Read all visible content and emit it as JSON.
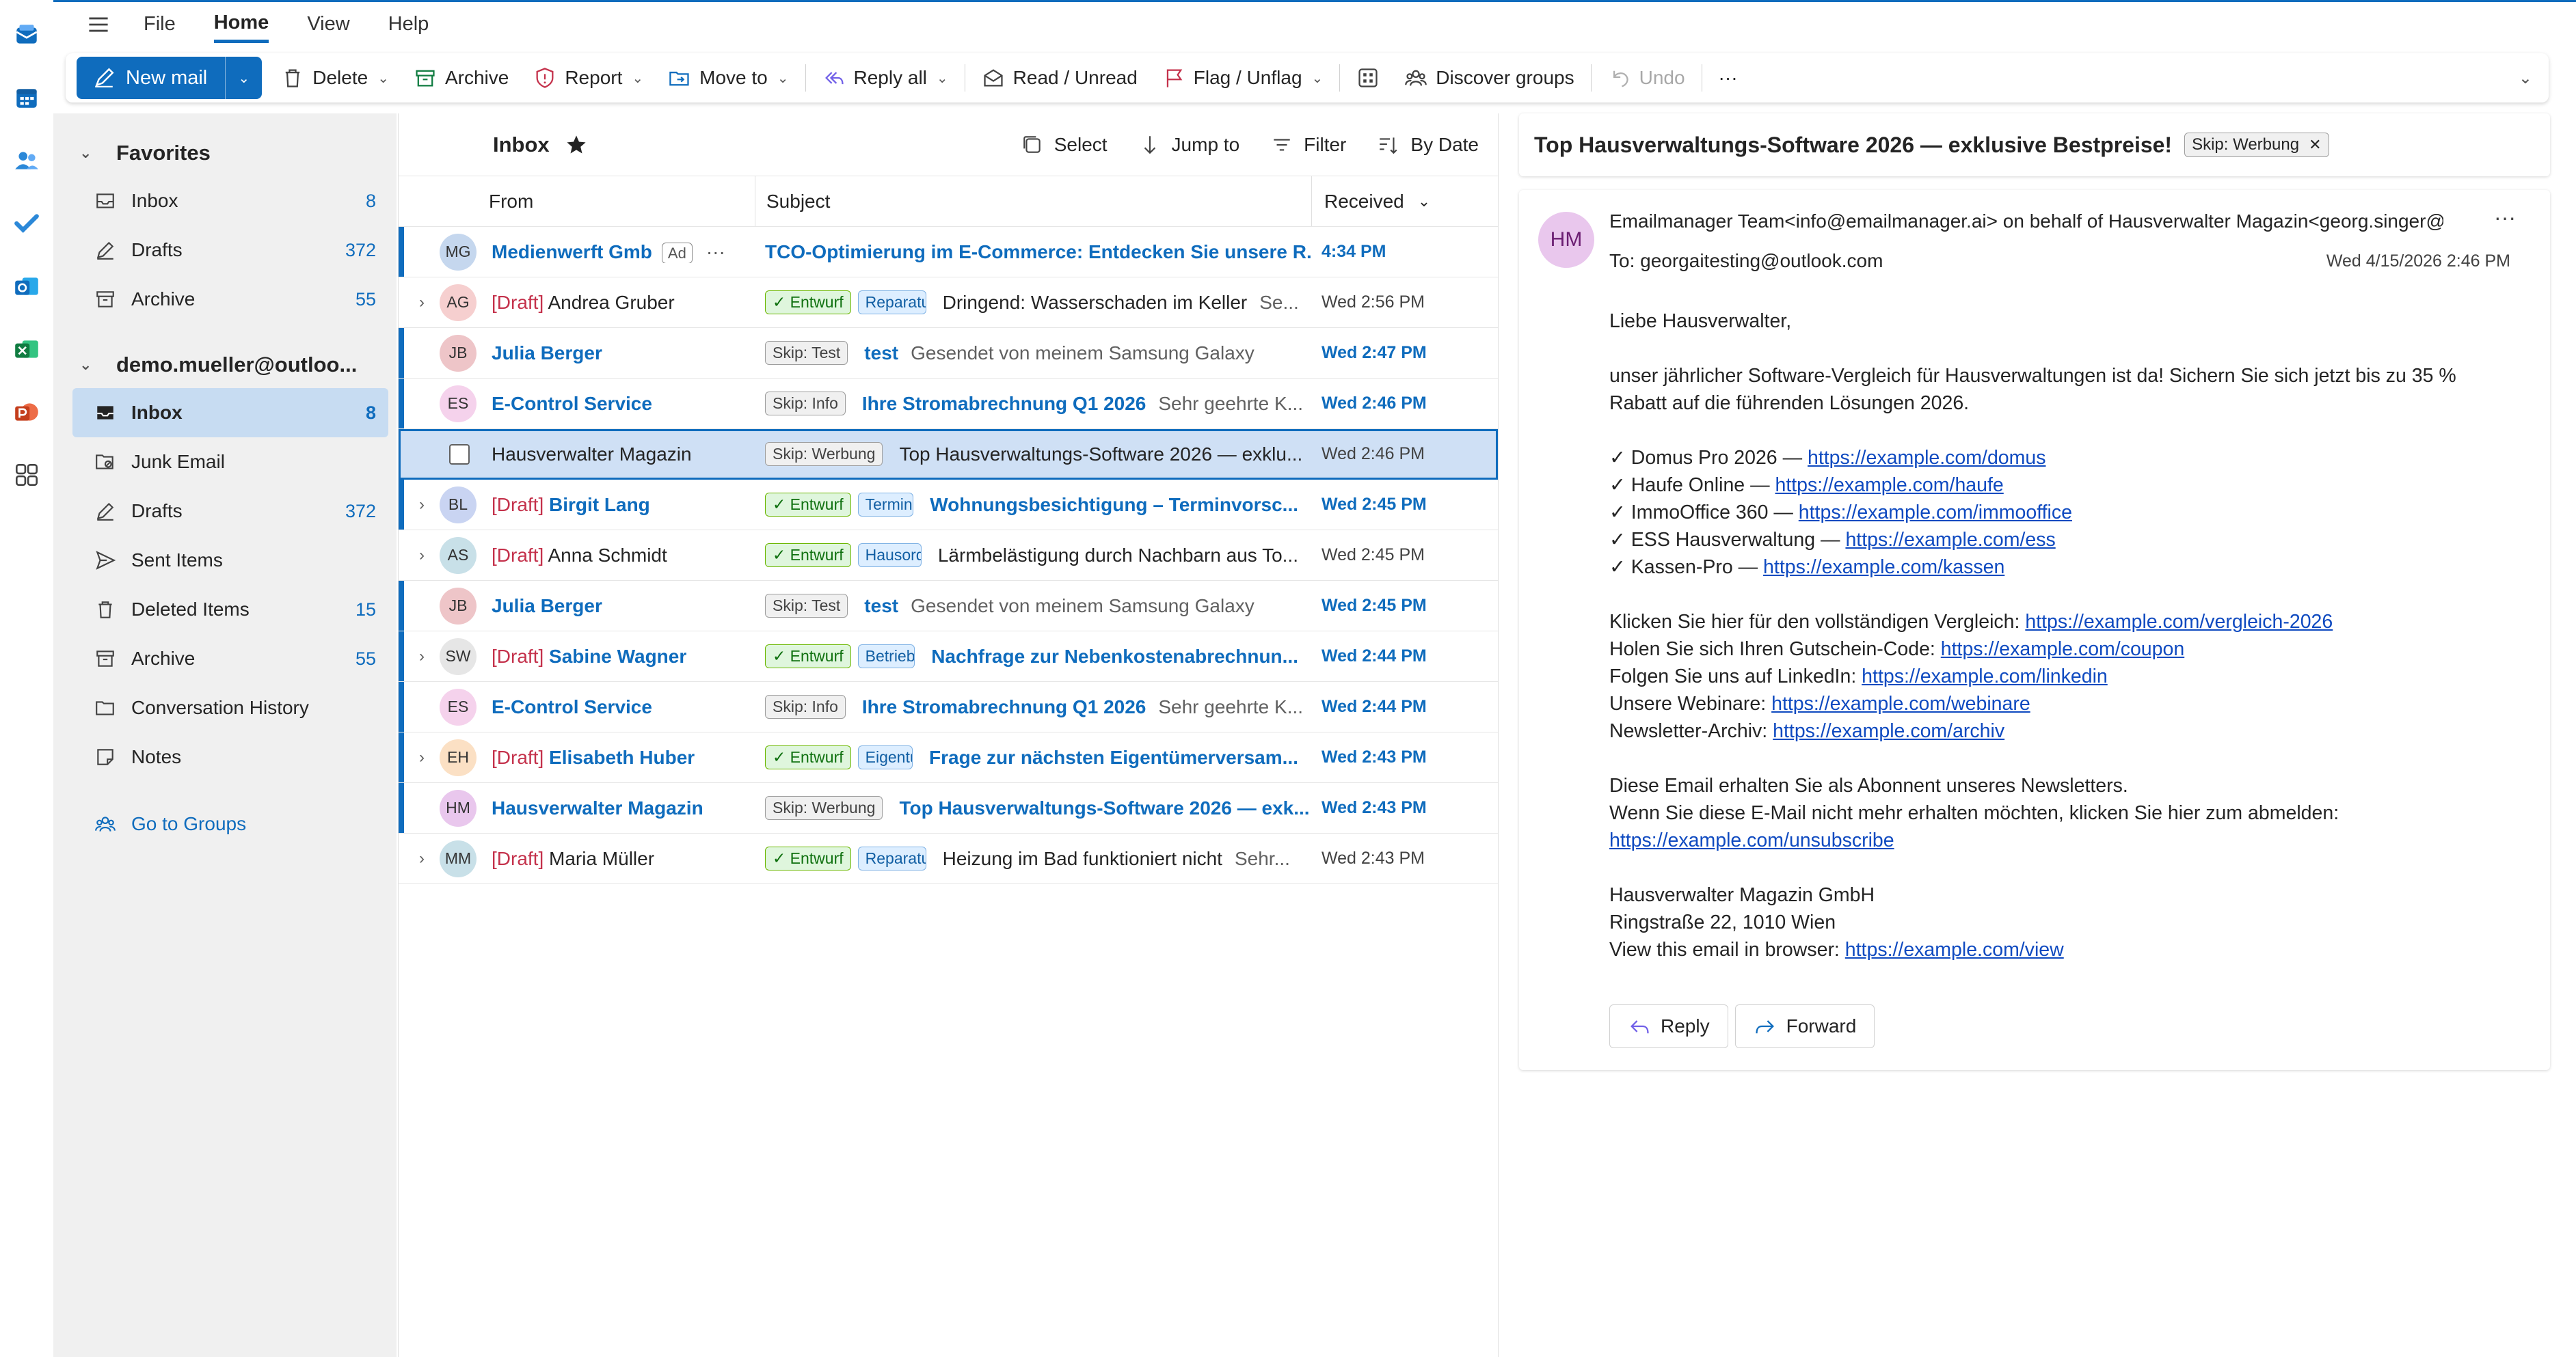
{
  "menubar": {
    "menus": [
      "File",
      "Home",
      "View",
      "Help"
    ],
    "active": "Home"
  },
  "ribbon": {
    "new_mail": "New mail",
    "delete": "Delete",
    "archive": "Archive",
    "report": "Report",
    "move_to": "Move to",
    "reply_all": "Reply all",
    "read_unread": "Read / Unread",
    "flag_unflag": "Flag / Unflag",
    "discover_groups": "Discover groups",
    "undo": "Undo",
    "more": "···",
    "accent": "#0f6cbd"
  },
  "folders": {
    "favorites_label": "Favorites",
    "favorites": [
      {
        "label": "Inbox",
        "count": "8",
        "icon": "inbox-icon"
      },
      {
        "label": "Drafts",
        "count": "372",
        "icon": "drafts-icon"
      },
      {
        "label": "Archive",
        "count": "55",
        "icon": "archive-icon"
      }
    ],
    "account_label": "demo.mueller@outloo...",
    "account": [
      {
        "label": "Inbox",
        "count": "8",
        "icon": "inbox-icon",
        "selected": true
      },
      {
        "label": "Junk Email",
        "count": "",
        "icon": "junk-icon"
      },
      {
        "label": "Drafts",
        "count": "372",
        "icon": "drafts-icon"
      },
      {
        "label": "Sent Items",
        "count": "",
        "icon": "sent-icon"
      },
      {
        "label": "Deleted Items",
        "count": "15",
        "icon": "trash-icon"
      },
      {
        "label": "Archive",
        "count": "55",
        "icon": "archive-icon"
      },
      {
        "label": "Conversation History",
        "count": "",
        "icon": "folder-icon"
      },
      {
        "label": "Notes",
        "count": "",
        "icon": "notes-icon"
      }
    ],
    "go_to_groups": "Go to Groups"
  },
  "list": {
    "title": "Inbox",
    "tools": {
      "select": "Select",
      "jump_to": "Jump to",
      "filter": "Filter",
      "sort": "By Date"
    },
    "columns": {
      "from": "From",
      "subject": "Subject",
      "received": "Received"
    },
    "rows": [
      {
        "initials": "MG",
        "avatar_color": "#c5d7ee",
        "from": "Medienwerft Gmb",
        "draft": false,
        "unread": true,
        "ad": "Ad",
        "tags": [],
        "subject": "TCO-Optimierung im E-Commerce: Entdecken Sie unsere R...",
        "preview": "",
        "received": "4:34 PM",
        "expander": false
      },
      {
        "initials": "AG",
        "avatar_color": "#f6cfcf",
        "from": "Andrea Gruber",
        "draft": true,
        "unread": false,
        "tags": [
          {
            "t": "✓ Entwurf",
            "c": "green"
          },
          {
            "t": "Reparatu",
            "c": "blue"
          }
        ],
        "subject": "Dringend: Wasserschaden im Keller",
        "preview": "Se...",
        "received": "Wed 2:56 PM",
        "expander": true
      },
      {
        "initials": "JB",
        "avatar_color": "#eec5c8",
        "from": "Julia Berger",
        "draft": false,
        "unread": true,
        "tags": [
          {
            "t": "Skip: Test",
            "c": "gray"
          }
        ],
        "subject": "test",
        "preview": "Gesendet von meinem Samsung Galaxy",
        "received": "Wed 2:47 PM",
        "expander": false
      },
      {
        "initials": "ES",
        "avatar_color": "#f5d2ec",
        "from": "E-Control Service",
        "draft": false,
        "unread": true,
        "tags": [
          {
            "t": "Skip: Info",
            "c": "gray"
          }
        ],
        "subject": "Ihre Stromabrechnung Q1 2026",
        "preview": "Sehr geehrte K...",
        "received": "Wed 2:46 PM",
        "expander": false
      },
      {
        "initials": "",
        "avatar_color": "",
        "from": "Hausverwalter Magazin",
        "draft": false,
        "unread": false,
        "selected": true,
        "tags": [
          {
            "t": "Skip: Werbung",
            "c": "gray"
          }
        ],
        "subject": "Top Hausverwaltungs-Software 2026 — exklu...",
        "preview": "",
        "received": "Wed 2:46 PM",
        "expander": false
      },
      {
        "initials": "BL",
        "avatar_color": "#c9d4f2",
        "from": "Birgit Lang",
        "draft": true,
        "unread": true,
        "tags": [
          {
            "t": "✓ Entwurf",
            "c": "green"
          },
          {
            "t": "Terminal",
            "c": "blue"
          }
        ],
        "subject": "Wohnungsbesichtigung – Terminvorsc...",
        "preview": "",
        "received": "Wed 2:45 PM",
        "expander": true
      },
      {
        "initials": "AS",
        "avatar_color": "#c8e0e8",
        "from": "Anna Schmidt",
        "draft": true,
        "unread": false,
        "tags": [
          {
            "t": "✓ Entwurf",
            "c": "green"
          },
          {
            "t": "Hausord",
            "c": "blue"
          }
        ],
        "subject": "Lärmbelästigung durch Nachbarn aus To...",
        "preview": "",
        "received": "Wed 2:45 PM",
        "expander": true
      },
      {
        "initials": "JB",
        "avatar_color": "#eec5c8",
        "from": "Julia Berger",
        "draft": false,
        "unread": true,
        "tags": [
          {
            "t": "Skip: Test",
            "c": "gray"
          }
        ],
        "subject": "test",
        "preview": "Gesendet von meinem Samsung Galaxy",
        "received": "Wed 2:45 PM",
        "expander": false
      },
      {
        "initials": "SW",
        "avatar_color": "#e6e6e6",
        "from": "Sabine Wagner",
        "draft": true,
        "unread": true,
        "tags": [
          {
            "t": "✓ Entwurf",
            "c": "green"
          },
          {
            "t": "Betriebs",
            "c": "blue"
          }
        ],
        "subject": "Nachfrage zur Nebenkostenabrechnun...",
        "preview": "",
        "received": "Wed 2:44 PM",
        "expander": true
      },
      {
        "initials": "ES",
        "avatar_color": "#f5d2ec",
        "from": "E-Control Service",
        "draft": false,
        "unread": true,
        "tags": [
          {
            "t": "Skip: Info",
            "c": "gray"
          }
        ],
        "subject": "Ihre Stromabrechnung Q1 2026",
        "preview": "Sehr geehrte K...",
        "received": "Wed 2:44 PM",
        "expander": false
      },
      {
        "initials": "EH",
        "avatar_color": "#fbe0c4",
        "from": "Elisabeth Huber",
        "draft": true,
        "unread": true,
        "tags": [
          {
            "t": "✓ Entwurf",
            "c": "green"
          },
          {
            "t": "Eigentür",
            "c": "blue"
          }
        ],
        "subject": "Frage zur nächsten Eigentümerversam...",
        "preview": "",
        "received": "Wed 2:43 PM",
        "expander": true
      },
      {
        "initials": "HM",
        "avatar_color": "#e9c7ed",
        "from": "Hausverwalter Magazin",
        "draft": false,
        "unread": true,
        "tags": [
          {
            "t": "Skip: Werbung",
            "c": "gray"
          }
        ],
        "subject": "Top Hausverwaltungs-Software 2026 — exk...",
        "preview": "",
        "received": "Wed 2:43 PM",
        "expander": false
      },
      {
        "initials": "MM",
        "avatar_color": "#c8e0e8",
        "from": "Maria Müller",
        "draft": true,
        "unread": false,
        "tags": [
          {
            "t": "✓ Entwurf",
            "c": "green"
          },
          {
            "t": "Reparatu",
            "c": "blue"
          }
        ],
        "subject": "Heizung im Bad funktioniert nicht",
        "preview": "Sehr...",
        "received": "Wed 2:43 PM",
        "expander": true
      }
    ]
  },
  "reading": {
    "title": "Top Hausverwaltungs-Software 2026 — exklusive Bestpreise!",
    "tag": "Skip: Werbung",
    "avatar": "HM",
    "sender": "Emailmanager Team<info@emailmanager.ai> on behalf of Hausverwalter Magazin<georg.singer@",
    "to_label": "To:",
    "to": "georgaitesting@outlook.com",
    "date": "Wed 4/15/2026 2:46 PM",
    "greeting": "Liebe Hausverwalter,",
    "intro": "unser jährlicher Software-Vergleich für Hausverwaltungen ist da! Sichern Sie sich jetzt bis zu 35 % Rabatt auf die führenden Lösungen 2026.",
    "products": [
      {
        "name": "✓ Domus Pro 2026 — ",
        "url": "https://example.com/domus"
      },
      {
        "name": "✓ Haufe Online — ",
        "url": "https://example.com/haufe"
      },
      {
        "name": "✓ ImmoOffice 360 — ",
        "url": "https://example.com/immooffice"
      },
      {
        "name": "✓ ESS Hausverwaltung — ",
        "url": "https://example.com/ess"
      },
      {
        "name": "✓ Kassen-Pro — ",
        "url": "https://example.com/kassen"
      }
    ],
    "links": [
      {
        "text": "Klicken Sie hier für den vollständigen Vergleich: ",
        "url": "https://example.com/vergleich-2026"
      },
      {
        "text": "Holen Sie sich Ihren Gutschein-Code: ",
        "url": "https://example.com/coupon"
      },
      {
        "text": "Folgen Sie uns auf LinkedIn: ",
        "url": "https://example.com/linkedin"
      },
      {
        "text": "Unsere Webinare: ",
        "url": "https://example.com/webinare"
      },
      {
        "text": "Newsletter-Archiv: ",
        "url": "https://example.com/archiv"
      }
    ],
    "footer1": "Diese Email erhalten Sie als Abonnent unseres Newsletters.",
    "footer2": "Wenn Sie diese E-Mail nicht mehr erhalten möchten, klicken Sie hier zum abmelden:",
    "unsubscribe": "https://example.com/unsubscribe",
    "company": "Hausverwalter Magazin GmbH",
    "address": "Ringstraße 22, 1010 Wien",
    "view_label": "View this email in browser: ",
    "view_url": "https://example.com/view",
    "reply": "Reply",
    "forward": "Forward"
  }
}
